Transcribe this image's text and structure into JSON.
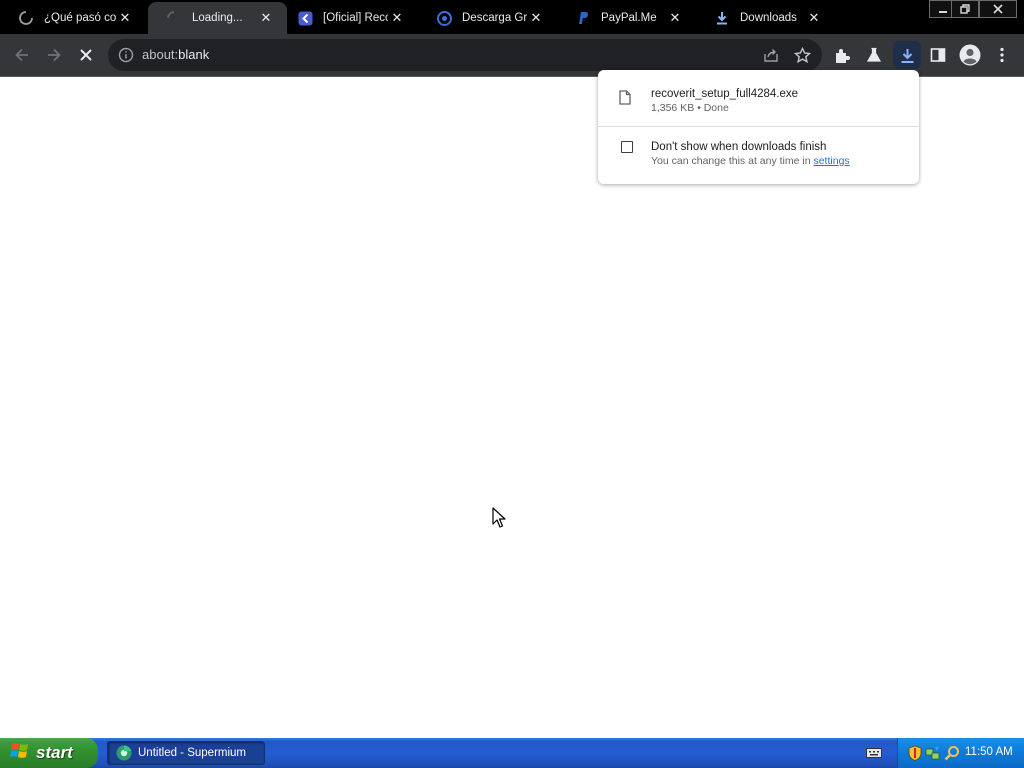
{
  "browser": {
    "tabs": [
      {
        "title": "¿Qué pasó co",
        "favicon": "loading-spinner-icon",
        "active": false
      },
      {
        "title": "Loading...",
        "favicon": "loading-spinner-icon",
        "active": true
      },
      {
        "title": "[Oficial] Recov",
        "favicon": "recoverit-icon",
        "active": false
      },
      {
        "title": "Descarga Grat",
        "favicon": "descarga-site-icon",
        "active": false
      },
      {
        "title": "PayPal.Me",
        "favicon": "paypal-icon",
        "active": false
      },
      {
        "title": "Downloads",
        "favicon": "download-icon",
        "active": false
      }
    ],
    "window_controls": [
      "minimize",
      "restore",
      "close"
    ],
    "omnibox": {
      "scheme": "about:",
      "rest": "blank"
    },
    "toolbar_icons": [
      "back-icon",
      "forward-icon",
      "stop-icon",
      "share-icon",
      "bookmark-star-icon",
      "extensions-icon",
      "labs-flask-icon",
      "downloads-icon",
      "side-panel-icon",
      "profile-icon",
      "menu-icon"
    ],
    "colors": {
      "tabstrip": "#000000",
      "toolbar": "#35363a",
      "omnibox": "#202124",
      "downloads_active": "#8ab4f8"
    }
  },
  "download_bubble": {
    "file_name": "recoverit_setup_full4284.exe",
    "file_status": "1,356 KB • Done",
    "option_label": "Don't show when downloads finish",
    "option_hint_prefix": "You can change this at any time in ",
    "option_hint_link": "settings",
    "option_checked": false
  },
  "taskbar": {
    "start_label": "start",
    "task_item": "Untitled - Supermium",
    "clock": "11:50 AM",
    "tray_icons": [
      "keyboard-icon",
      "security-shield-icon",
      "network-icon",
      "search-icon"
    ]
  }
}
